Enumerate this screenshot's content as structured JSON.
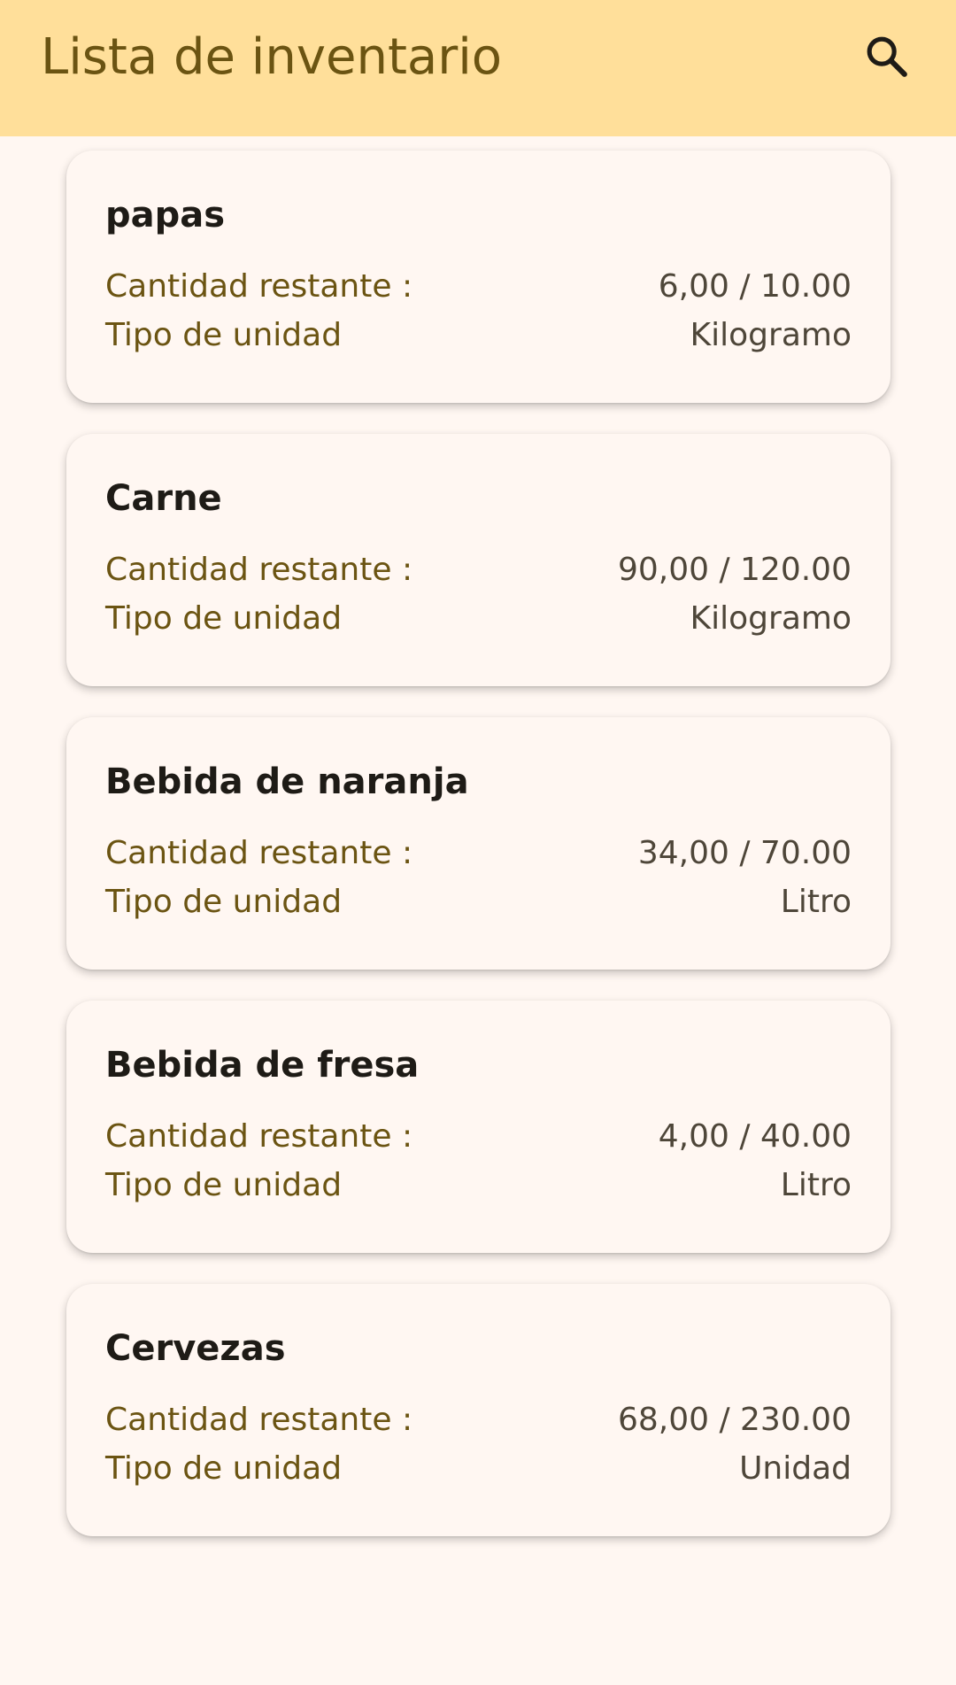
{
  "app_bar": {
    "title": "Lista de inventario",
    "search_icon": "search-icon"
  },
  "labels": {
    "quantity": "Cantidad restante :",
    "unit_type": "Tipo de unidad"
  },
  "items": [
    {
      "name": "papas",
      "quantity": "6,00 / 10.00",
      "unit": "Kilogramo"
    },
    {
      "name": "Carne",
      "quantity": "90,00 / 120.00",
      "unit": "Kilogramo"
    },
    {
      "name": "Bebida de naranja",
      "quantity": "34,00 / 70.00",
      "unit": "Litro"
    },
    {
      "name": "Bebida de fresa",
      "quantity": "4,00 / 40.00",
      "unit": "Litro"
    },
    {
      "name": "Cervezas",
      "quantity": "68,00 / 230.00",
      "unit": "Unidad"
    }
  ],
  "colors": {
    "app_bar_bg": "#FFDF9A",
    "title": "#6B5412",
    "background": "#FFF7F2",
    "card_title": "#1E1B16",
    "value_text": "#4E4639"
  }
}
